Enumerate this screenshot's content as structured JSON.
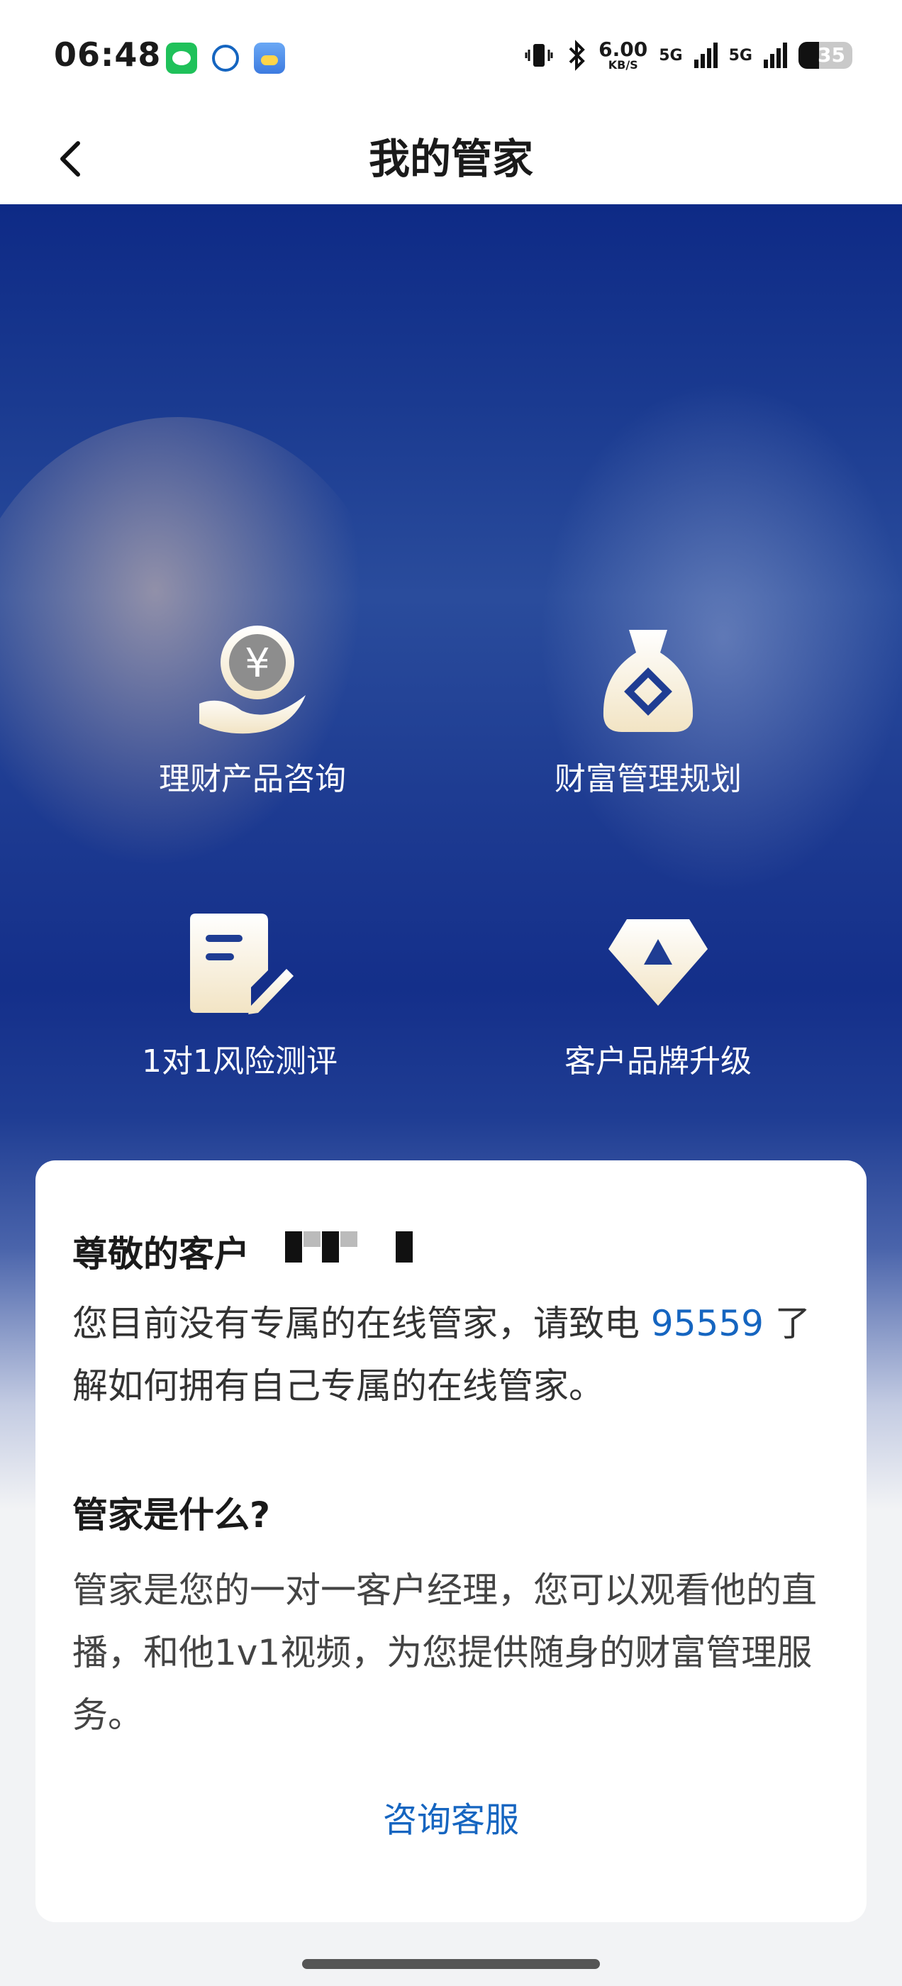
{
  "status_bar": {
    "time": "06:48",
    "net_speed_value": "6.00",
    "net_speed_unit": "KB/S",
    "signal_1_label": "5G",
    "signal_2_label": "5G",
    "battery_level": "35",
    "icons": [
      "wechat-icon",
      "payment-app-icon",
      "weather-icon",
      "vibrate-icon",
      "bluetooth-icon"
    ]
  },
  "nav": {
    "title": "我的管家",
    "back_icon": "chevron-left-icon"
  },
  "features": [
    {
      "label": "理财产品咨询",
      "icon": "yuan-coin-hand-icon"
    },
    {
      "label": "财富管理规划",
      "icon": "money-bag-icon"
    },
    {
      "label": "1对1风险测评",
      "icon": "document-pen-icon"
    },
    {
      "label": "客户品牌升级",
      "icon": "diamond-icon"
    }
  ],
  "card": {
    "greeting": "尊敬的客户",
    "no_manager_text": "您目前没有专属的在线管家，请致电",
    "phone": "95559",
    "no_manager_text_2": "了解如何拥有自己专属的在线管家。",
    "what_title": "管家是什么?",
    "what_body": "管家是您的一对一客户经理，您可以观看他的直播，和他1v1视频，为您提供随身的财富管理服务。",
    "consult_label": "咨询客服"
  },
  "colors": {
    "accent": "#1565c0",
    "hero_top": "#0e2a86",
    "icon_gradient_top": "#ffffff",
    "icon_gradient_bottom": "#f2e4c4"
  }
}
